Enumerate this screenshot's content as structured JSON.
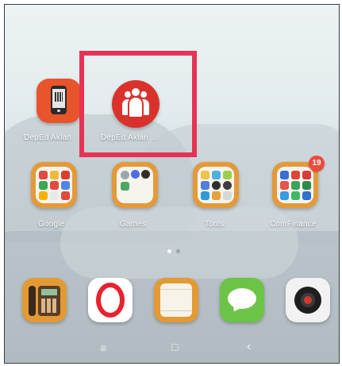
{
  "home_screen": {
    "apps": [
      {
        "label": "DepEd Aklan"
      },
      {
        "label": "DepEd Aklan ..."
      }
    ],
    "folders": [
      {
        "label": "Google"
      },
      {
        "label": "Games"
      },
      {
        "label": "Tools"
      },
      {
        "label": "ComFinance",
        "badge": "19"
      }
    ],
    "page_indicator": {
      "pages": 2,
      "current": 1
    }
  },
  "dock": {
    "apps": [
      {
        "icon": "phone-icon"
      },
      {
        "icon": "opera-browser-icon"
      },
      {
        "icon": "notes-icon"
      },
      {
        "icon": "messages-icon"
      },
      {
        "icon": "camera-icon"
      }
    ]
  },
  "navigation_bar": {
    "menu_symbol": "≡",
    "home_symbol": "□",
    "back_symbol": "‹"
  },
  "colors": {
    "highlight": "#e63355",
    "deped_orange": "#e8542c",
    "deped_red": "#d9322c",
    "folder": "#e39a3a",
    "badge": "#ee4b3a"
  }
}
